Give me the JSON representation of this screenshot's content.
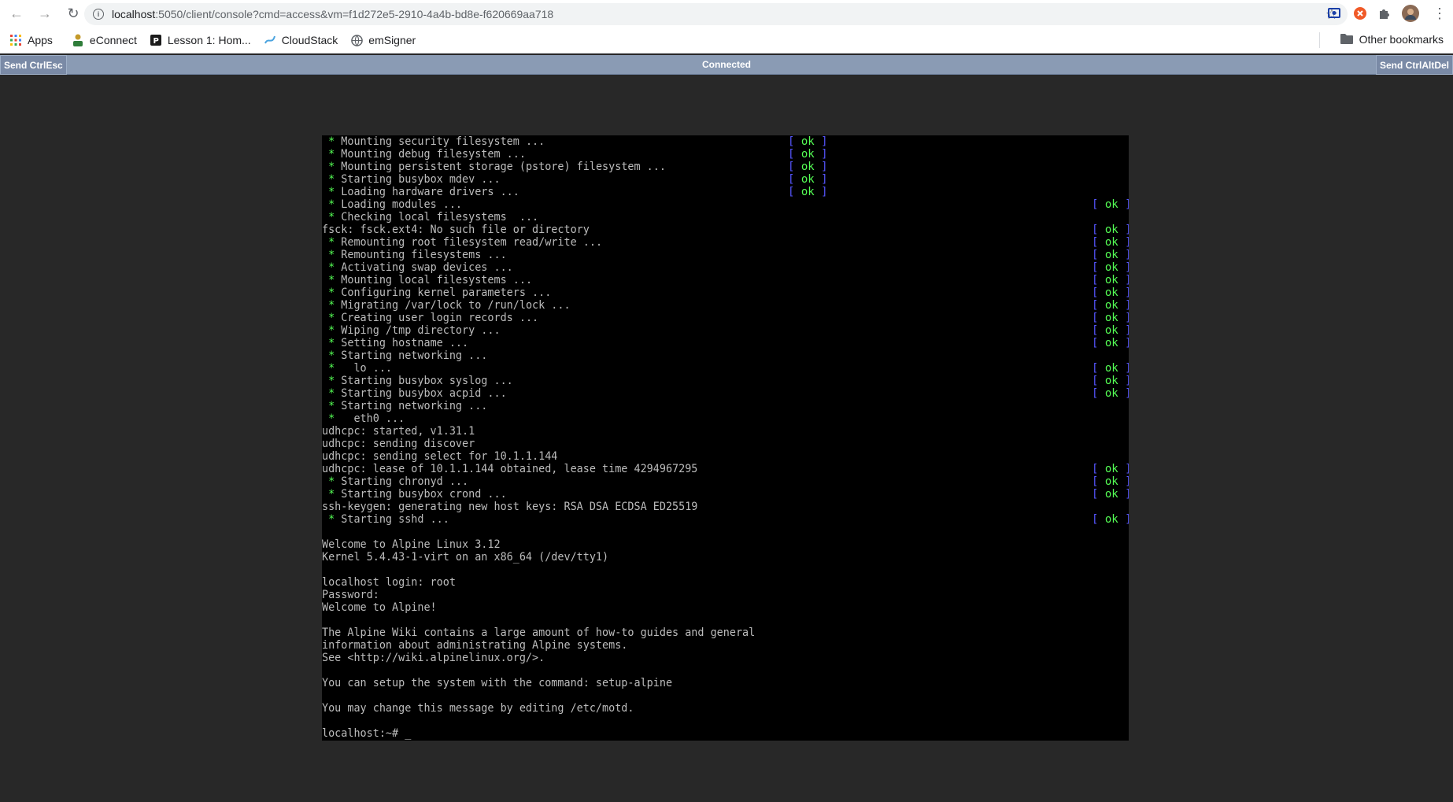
{
  "browser": {
    "url_host": "localhost",
    "url_rest": ":5050/client/console?cmd=access&vm=f1d272e5-2910-4a4b-bd8e-f620669aa718",
    "bookmarks": [
      "Apps",
      "eConnect",
      "Lesson 1: Hom...",
      "CloudStack",
      "emSigner"
    ],
    "other_bookmarks": "Other bookmarks"
  },
  "vnc": {
    "left_button": "Send CtrlEsc",
    "status": "Connected",
    "right_button": "Send CtrlAltDel"
  },
  "console": {
    "lines": [
      {
        "star": true,
        "text": "Mounting security filesystem ...",
        "ok": "short"
      },
      {
        "star": true,
        "text": "Mounting debug filesystem ...",
        "ok": "short"
      },
      {
        "star": true,
        "text": "Mounting persistent storage (pstore) filesystem ...",
        "ok": "short"
      },
      {
        "star": true,
        "text": "Starting busybox mdev ...",
        "ok": "short"
      },
      {
        "star": true,
        "text": "Loading hardware drivers ...",
        "ok": "short"
      },
      {
        "star": true,
        "text": "Loading modules ...",
        "ok": "right"
      },
      {
        "star": true,
        "text": "Checking local filesystems  ...",
        "ok": ""
      },
      {
        "star": false,
        "text": "fsck: fsck.ext4: No such file or directory",
        "ok": "right"
      },
      {
        "star": true,
        "text": "Remounting root filesystem read/write ...",
        "ok": "right"
      },
      {
        "star": true,
        "text": "Remounting filesystems ...",
        "ok": "right"
      },
      {
        "star": true,
        "text": "Activating swap devices ...",
        "ok": "right"
      },
      {
        "star": true,
        "text": "Mounting local filesystems ...",
        "ok": "right"
      },
      {
        "star": true,
        "text": "Configuring kernel parameters ...",
        "ok": "right"
      },
      {
        "star": true,
        "text": "Migrating /var/lock to /run/lock ...",
        "ok": "right"
      },
      {
        "star": true,
        "text": "Creating user login records ...",
        "ok": "right"
      },
      {
        "star": true,
        "text": "Wiping /tmp directory ...",
        "ok": "right"
      },
      {
        "star": true,
        "text": "Setting hostname ...",
        "ok": "right"
      },
      {
        "star": true,
        "text": "Starting networking ...",
        "ok": ""
      },
      {
        "star": true,
        "text": "  lo ...",
        "ok": "right"
      },
      {
        "star": true,
        "text": "Starting busybox syslog ...",
        "ok": "right"
      },
      {
        "star": true,
        "text": "Starting busybox acpid ...",
        "ok": "right"
      },
      {
        "star": true,
        "text": "Starting networking ...",
        "ok": ""
      },
      {
        "star": true,
        "text": "  eth0 ...",
        "ok": ""
      },
      {
        "star": false,
        "text": "udhcpc: started, v1.31.1",
        "ok": ""
      },
      {
        "star": false,
        "text": "udhcpc: sending discover",
        "ok": ""
      },
      {
        "star": false,
        "text": "udhcpc: sending select for 10.1.1.144",
        "ok": ""
      },
      {
        "star": false,
        "text": "udhcpc: lease of 10.1.1.144 obtained, lease time 4294967295",
        "ok": "right"
      },
      {
        "star": true,
        "text": "Starting chronyd ...",
        "ok": "right"
      },
      {
        "star": true,
        "text": "Starting busybox crond ...",
        "ok": "right"
      },
      {
        "star": false,
        "text": "ssh-keygen: generating new host keys: RSA DSA ECDSA ED25519",
        "ok": ""
      },
      {
        "star": true,
        "text": "Starting sshd ...",
        "ok": "right"
      },
      {
        "star": false,
        "text": "",
        "ok": ""
      },
      {
        "star": false,
        "text": "Welcome to Alpine Linux 3.12",
        "ok": ""
      },
      {
        "star": false,
        "text": "Kernel 5.4.43-1-virt on an x86_64 (/dev/tty1)",
        "ok": ""
      },
      {
        "star": false,
        "text": "",
        "ok": ""
      },
      {
        "star": false,
        "text": "localhost login: root",
        "ok": ""
      },
      {
        "star": false,
        "text": "Password:",
        "ok": ""
      },
      {
        "star": false,
        "text": "Welcome to Alpine!",
        "ok": ""
      },
      {
        "star": false,
        "text": "",
        "ok": ""
      },
      {
        "star": false,
        "text": "The Alpine Wiki contains a large amount of how-to guides and general",
        "ok": ""
      },
      {
        "star": false,
        "text": "information about administrating Alpine systems.",
        "ok": ""
      },
      {
        "star": false,
        "text": "See <http://wiki.alpinelinux.org/>.",
        "ok": ""
      },
      {
        "star": false,
        "text": "",
        "ok": ""
      },
      {
        "star": false,
        "text": "You can setup the system with the command: setup-alpine",
        "ok": ""
      },
      {
        "star": false,
        "text": "",
        "ok": ""
      },
      {
        "star": false,
        "text": "You may change this message by editing /etc/motd.",
        "ok": ""
      },
      {
        "star": false,
        "text": "",
        "ok": ""
      },
      {
        "star": false,
        "text": "localhost:~# _",
        "ok": ""
      }
    ],
    "ok_label": "ok",
    "ok_open": "[",
    "ok_close": "]"
  }
}
